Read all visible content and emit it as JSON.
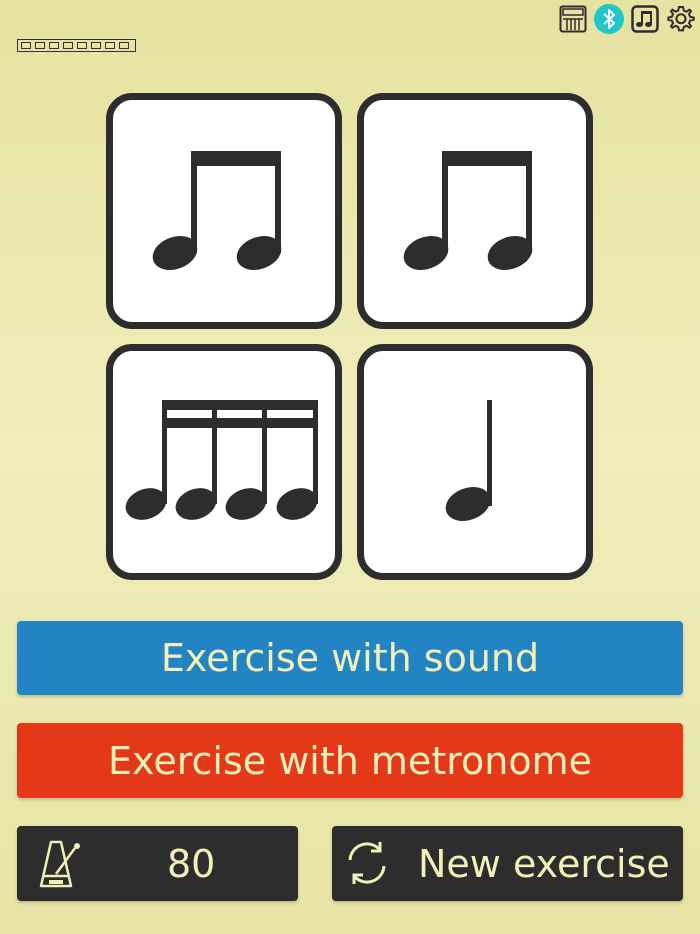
{
  "top_icons": [
    "keyboard-icon",
    "bluetooth-icon",
    "music-notes-icon",
    "gear-icon"
  ],
  "progress": {
    "cells": 8,
    "completed": 0
  },
  "tiles": [
    {
      "name": "eighth-notes-pair",
      "label": "two beamed eighth notes"
    },
    {
      "name": "eighth-notes-pair",
      "label": "two beamed eighth notes"
    },
    {
      "name": "sixteenth-notes-group",
      "label": "four beamed sixteenth notes"
    },
    {
      "name": "quarter-note",
      "label": "quarter note"
    }
  ],
  "buttons": {
    "exercise_sound": "Exercise with sound",
    "exercise_metronome": "Exercise with metronome",
    "tempo": "80",
    "new_exercise": "New exercise"
  },
  "colors": {
    "sound_button": "#2284c3",
    "metronome_button": "#e43819",
    "dark_button": "#2d2d2d",
    "button_text": "#f2f0b8",
    "bluetooth_accent": "#1ec8c8"
  }
}
